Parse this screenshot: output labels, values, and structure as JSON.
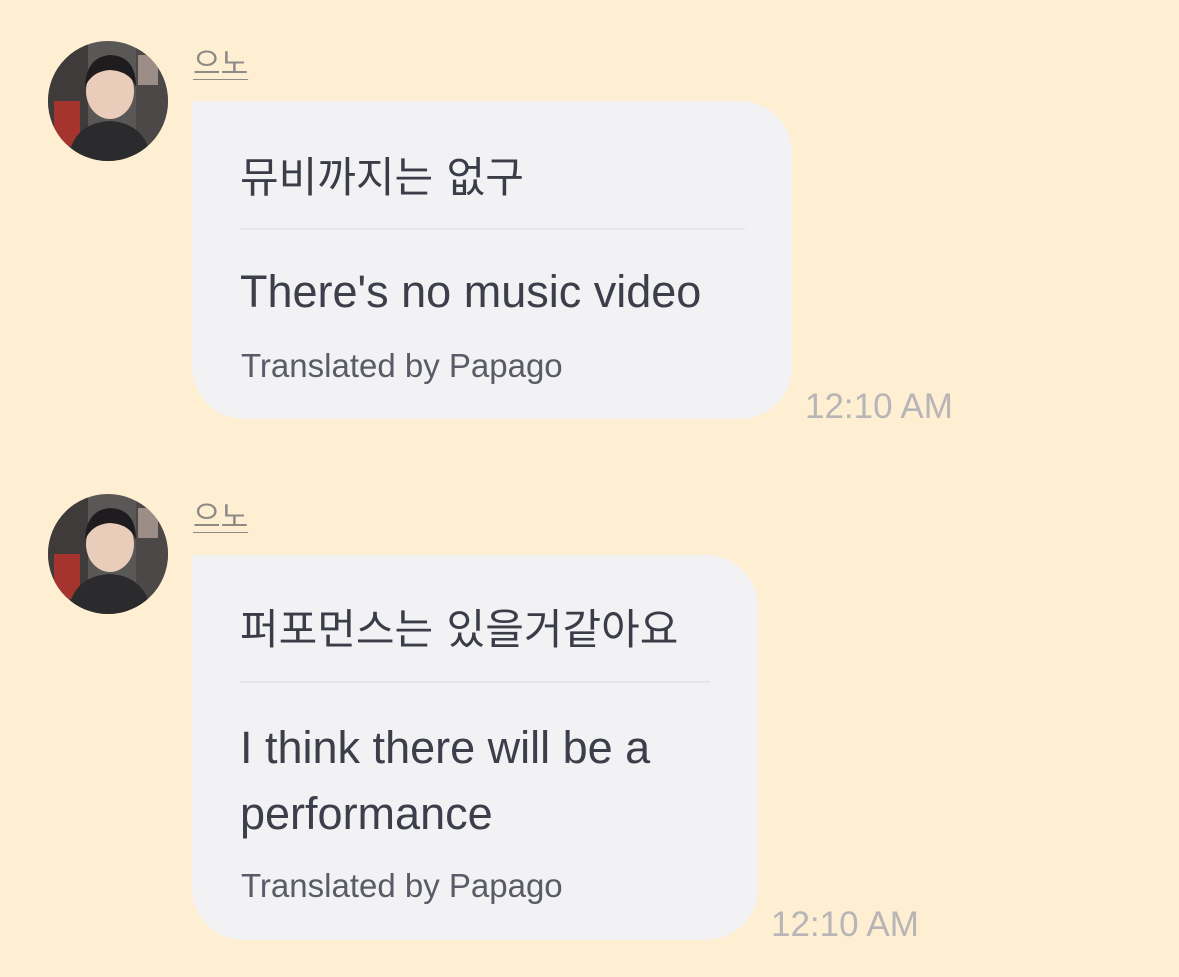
{
  "messages": [
    {
      "sender": "으노",
      "avatar_icon": "profile-photo",
      "original_text": "뮤비까지는 없구",
      "translated_text": "There's no music video",
      "translation_credit": "Translated by Papago",
      "timestamp": "12:10 AM"
    },
    {
      "sender": "으노",
      "avatar_icon": "profile-photo",
      "original_text": "퍼포먼스는 있을거같아요",
      "translated_text": "I think there will be a performance",
      "translation_credit": "Translated by Papago",
      "timestamp": "12:10 AM"
    }
  ],
  "colors": {
    "background": "#FEEFD2",
    "bubble": "#F2F2F5",
    "text": "#3A3C47",
    "timestamp": "#B7B5B6"
  }
}
